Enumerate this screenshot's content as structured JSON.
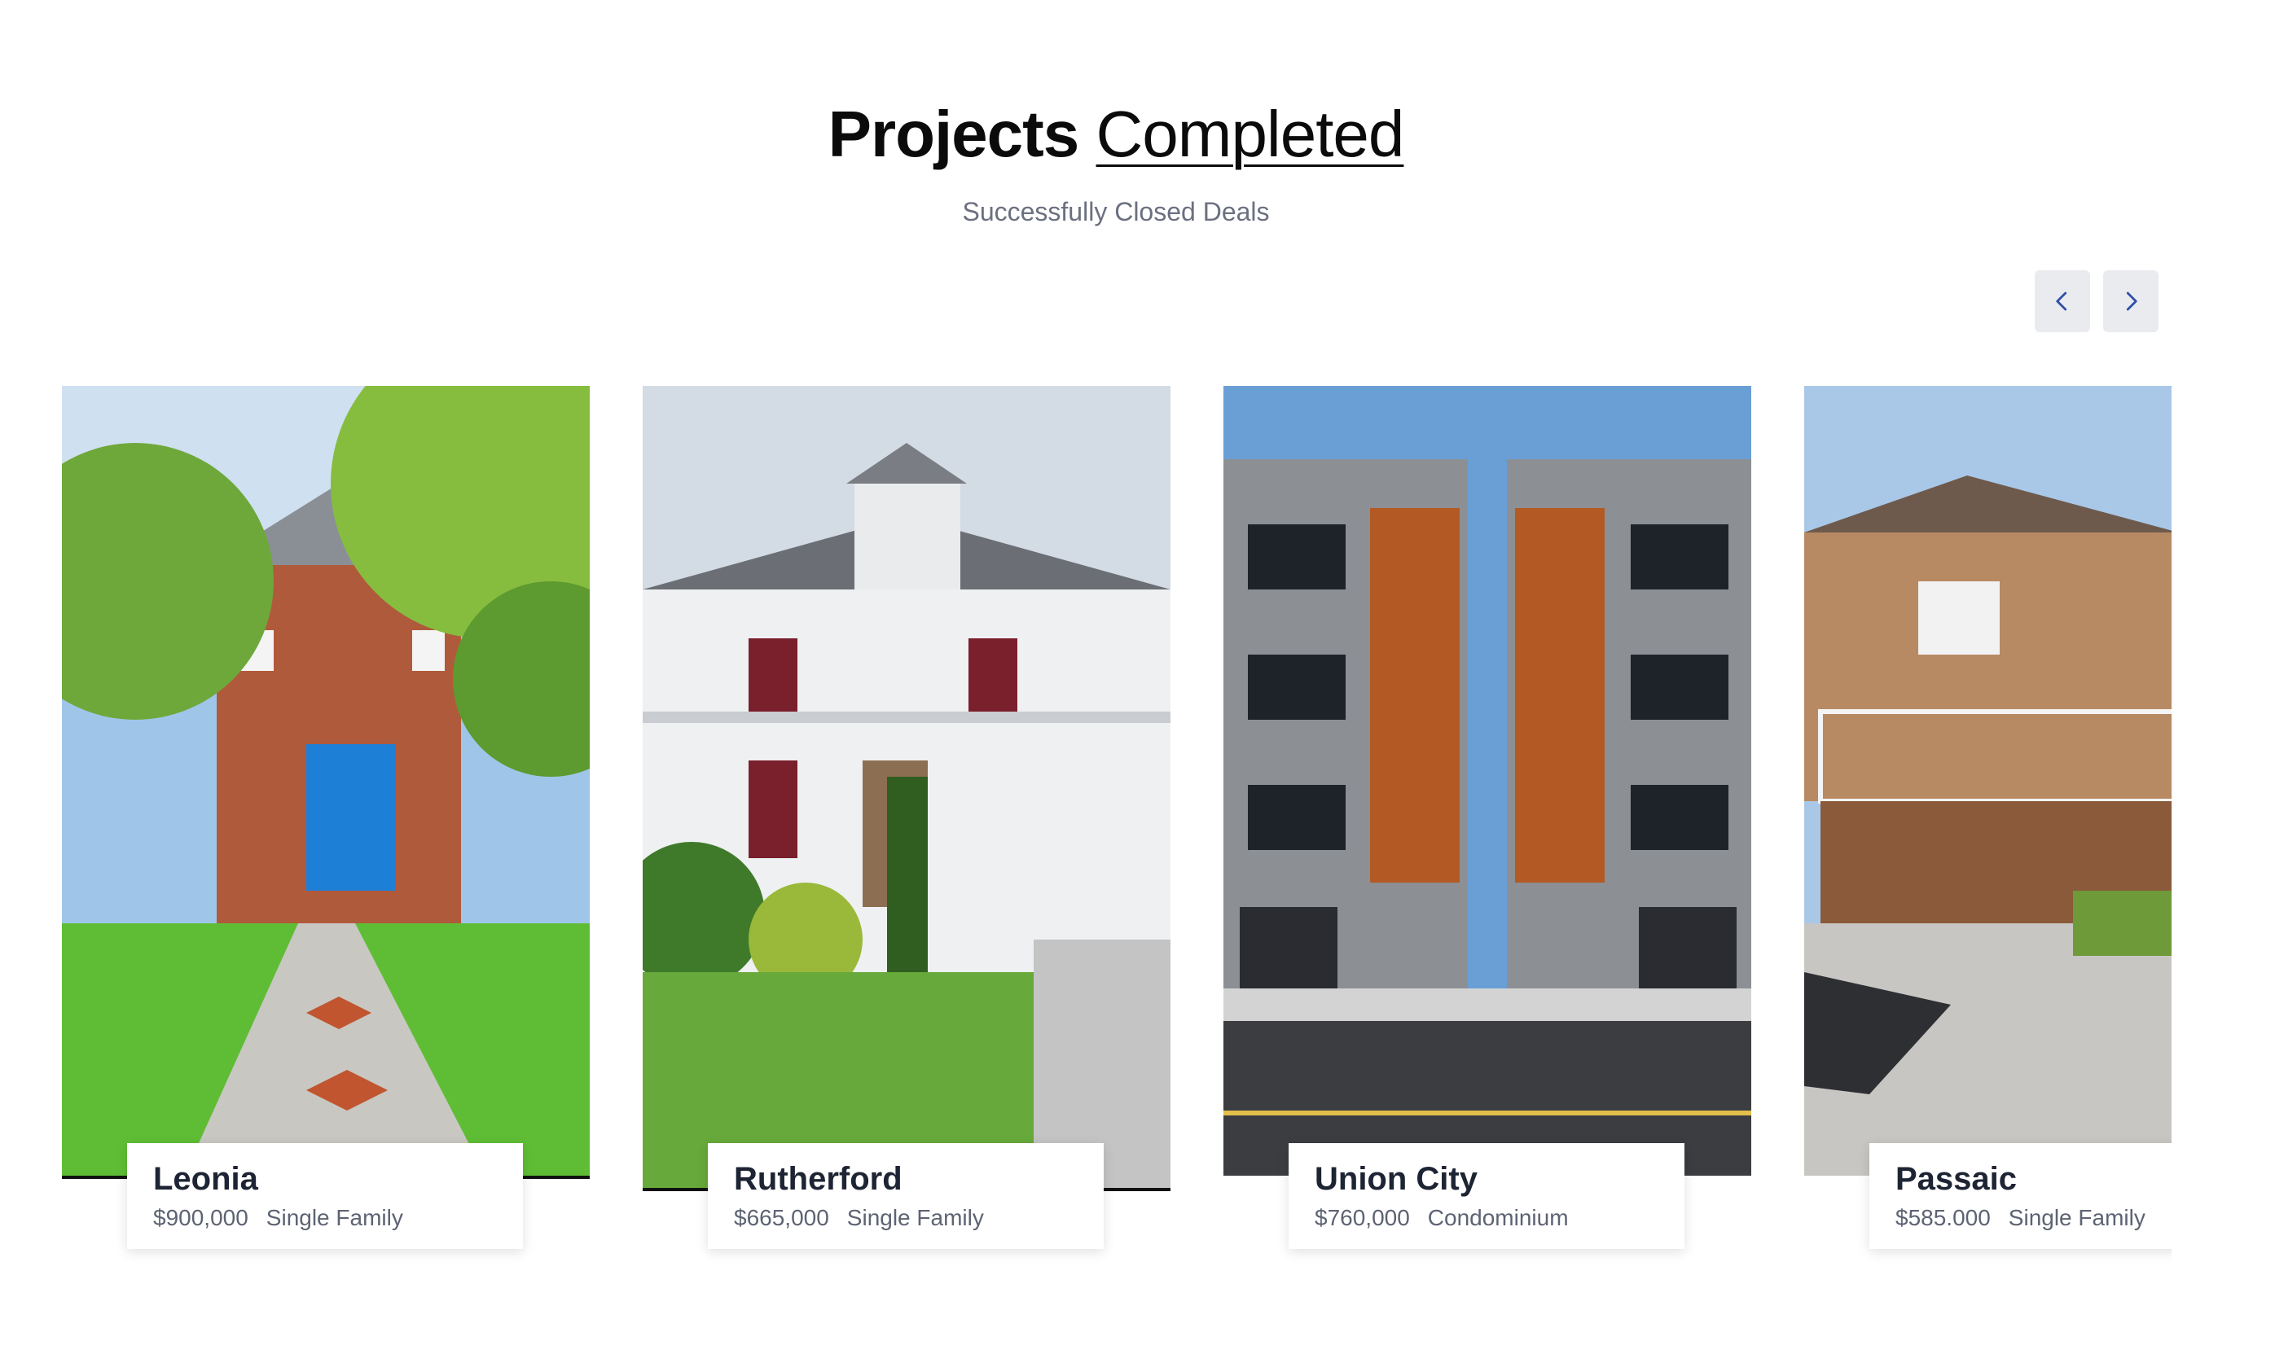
{
  "header": {
    "title_bold": "Projects",
    "title_light": "Completed",
    "subtitle": "Successfully Closed Deals"
  },
  "nav": {
    "prev_icon": "chevron-left-icon",
    "next_icon": "chevron-right-icon",
    "accent": "#2f4fa8"
  },
  "projects": [
    {
      "name": "Leonia",
      "price": "$900,000",
      "type": "Single Family"
    },
    {
      "name": "Rutherford",
      "price": "$665,000",
      "type": "Single Family"
    },
    {
      "name": "Union City",
      "price": "$760,000",
      "type": "Condominium"
    },
    {
      "name": "Passaic",
      "price": "$585.000",
      "type": "Single Family"
    }
  ]
}
